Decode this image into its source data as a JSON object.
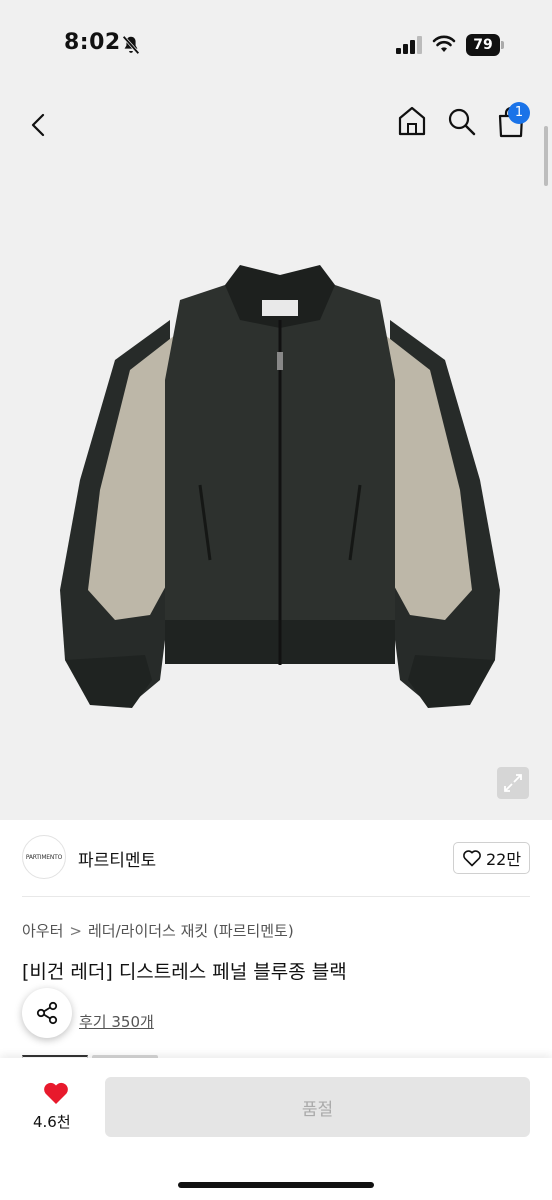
{
  "status_bar": {
    "time": "8:02",
    "battery": "79"
  },
  "nav": {
    "cart_count": "1"
  },
  "brand": {
    "logo_text": "PARTIMENTO",
    "name": "파르티멘토",
    "likes": "22만"
  },
  "breadcrumb": {
    "parent": "아우터",
    "separator": ">",
    "current": "레더/라이더스 재킷 (파르티멘토)"
  },
  "product": {
    "title": "[비건 레더] 디스트레스 페널 블루종 블랙",
    "reviews": "후기 350개"
  },
  "bottom_bar": {
    "wish_count": "4.6천",
    "buy_label": "품절"
  },
  "colors": {
    "badge": "#1a73e8",
    "heart": "#e8192c",
    "soldout_bg": "#e5e5e5",
    "soldout_text": "#aaaaaa"
  },
  "icons": [
    "bell-slash-icon",
    "signal-icon",
    "wifi-icon",
    "battery-icon",
    "back-chevron-icon",
    "home-icon",
    "search-icon",
    "cart-icon",
    "expand-icon",
    "heart-outline-icon",
    "share-icon",
    "heart-filled-icon"
  ]
}
